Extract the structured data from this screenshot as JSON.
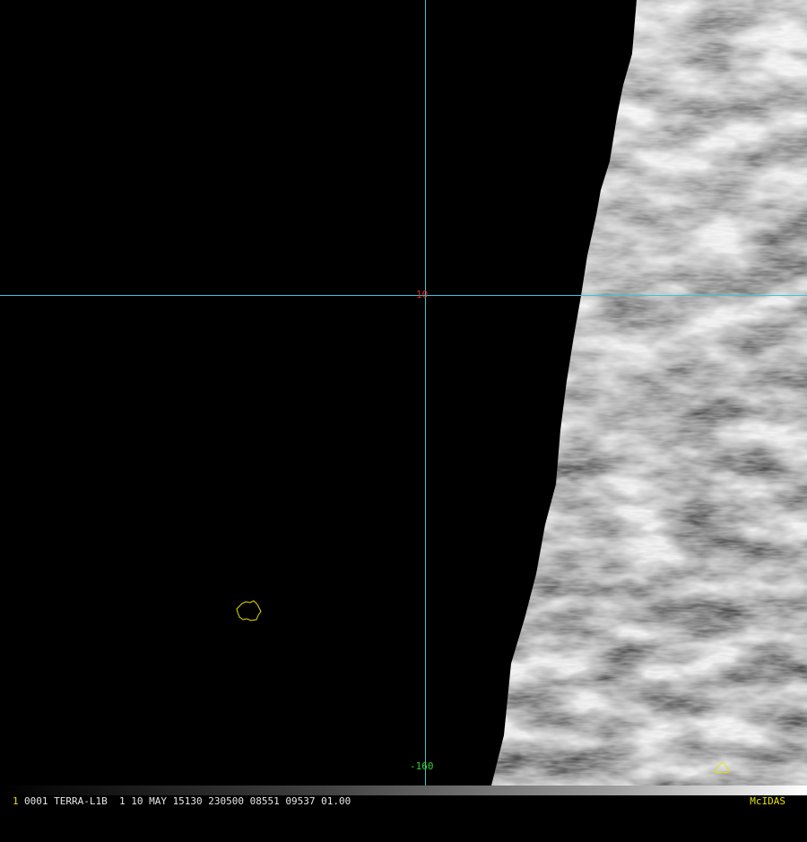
{
  "image": {
    "lat_label": "10",
    "lon_label": "-160",
    "grid_color": "#39c8d8",
    "lat_label_color": "#e03020",
    "lon_label_color": "#30d030",
    "coast_color": "#e8e000"
  },
  "status_bar": {
    "frame_number": "1",
    "text": "0001 TERRA-L1B  1 10 MAY 15130 230500 08551 09537 01.00",
    "brand": "McIDAS"
  }
}
